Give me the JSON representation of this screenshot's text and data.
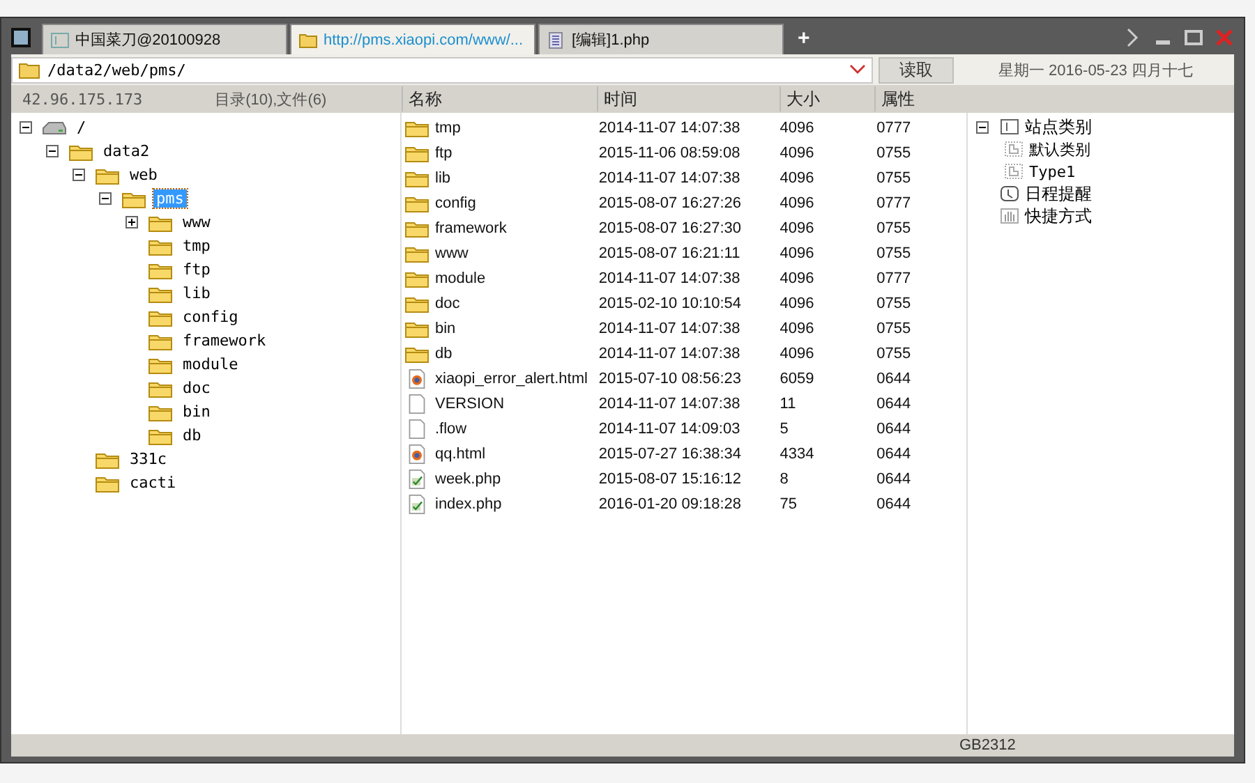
{
  "tabs": [
    {
      "label": "中国菜刀@20100928",
      "kind": "shell",
      "selected": false
    },
    {
      "label": "http://pms.xiaopi.com/www/...",
      "kind": "folder",
      "selected": true
    },
    {
      "label": "[编辑]1.php",
      "kind": "file",
      "selected": false
    }
  ],
  "new_tab": "+",
  "address": {
    "path": "/data2/web/pms/",
    "button": "读取",
    "date": "星期一 2016-05-23 四月十七"
  },
  "status": {
    "ip": "42.96.175.173",
    "summary": "目录(10),文件(6)"
  },
  "columns": [
    "名称",
    "时间",
    "大小",
    "属性"
  ],
  "tree": [
    {
      "label": "/",
      "kind": "drive",
      "expanded": true,
      "selected": false,
      "children": [
        {
          "label": "data2",
          "kind": "folder",
          "expanded": true,
          "selected": false,
          "children": [
            {
              "label": "web",
              "kind": "folder",
              "expanded": true,
              "selected": false,
              "children": [
                {
                  "label": "pms",
                  "kind": "folder",
                  "expanded": true,
                  "selected": true,
                  "children": [
                    {
                      "label": "www",
                      "kind": "folder",
                      "expanded": false,
                      "selected": false
                    },
                    {
                      "label": "tmp",
                      "kind": "folder",
                      "selected": false
                    },
                    {
                      "label": "ftp",
                      "kind": "folder",
                      "selected": false
                    },
                    {
                      "label": "lib",
                      "kind": "folder",
                      "selected": false
                    },
                    {
                      "label": "config",
                      "kind": "folder",
                      "selected": false
                    },
                    {
                      "label": "framework",
                      "kind": "folder",
                      "selected": false
                    },
                    {
                      "label": "module",
                      "kind": "folder",
                      "selected": false
                    },
                    {
                      "label": "doc",
                      "kind": "folder",
                      "selected": false
                    },
                    {
                      "label": "bin",
                      "kind": "folder",
                      "selected": false
                    },
                    {
                      "label": "db",
                      "kind": "folder",
                      "selected": false
                    }
                  ]
                }
              ]
            },
            {
              "label": "331c",
              "kind": "folder",
              "selected": false
            },
            {
              "label": "cacti",
              "kind": "folder",
              "selected": false
            }
          ]
        }
      ]
    }
  ],
  "files": [
    {
      "name": "tmp",
      "kind": "folder",
      "time": "2014-11-07 14:07:38",
      "size": "4096",
      "mode": "0777"
    },
    {
      "name": "ftp",
      "kind": "folder",
      "time": "2015-11-06 08:59:08",
      "size": "4096",
      "mode": "0755"
    },
    {
      "name": "lib",
      "kind": "folder",
      "time": "2014-11-07 14:07:38",
      "size": "4096",
      "mode": "0755"
    },
    {
      "name": "config",
      "kind": "folder",
      "time": "2015-08-07 16:27:26",
      "size": "4096",
      "mode": "0777"
    },
    {
      "name": "framework",
      "kind": "folder",
      "time": "2015-08-07 16:27:30",
      "size": "4096",
      "mode": "0755"
    },
    {
      "name": "www",
      "kind": "folder",
      "time": "2015-08-07 16:21:11",
      "size": "4096",
      "mode": "0755"
    },
    {
      "name": "module",
      "kind": "folder",
      "time": "2014-11-07 14:07:38",
      "size": "4096",
      "mode": "0777"
    },
    {
      "name": "doc",
      "kind": "folder",
      "time": "2015-02-10 10:10:54",
      "size": "4096",
      "mode": "0755"
    },
    {
      "name": "bin",
      "kind": "folder",
      "time": "2014-11-07 14:07:38",
      "size": "4096",
      "mode": "0755"
    },
    {
      "name": "db",
      "kind": "folder",
      "time": "2014-11-07 14:07:38",
      "size": "4096",
      "mode": "0755"
    },
    {
      "name": "xiaopi_error_alert.html",
      "kind": "html",
      "time": "2015-07-10 08:56:23",
      "size": "6059",
      "mode": "0644"
    },
    {
      "name": "VERSION",
      "kind": "text",
      "time": "2014-11-07 14:07:38",
      "size": "11",
      "mode": "0644"
    },
    {
      "name": ".flow",
      "kind": "text",
      "time": "2014-11-07 14:09:03",
      "size": "5",
      "mode": "0644"
    },
    {
      "name": "qq.html",
      "kind": "html",
      "time": "2015-07-27 16:38:34",
      "size": "4334",
      "mode": "0644"
    },
    {
      "name": "week.php",
      "kind": "php",
      "time": "2015-08-07 15:16:12",
      "size": "8",
      "mode": "0644"
    },
    {
      "name": "index.php",
      "kind": "php",
      "time": "2016-01-20 09:18:28",
      "size": "75",
      "mode": "0644"
    }
  ],
  "sites": [
    {
      "label": "站点类别",
      "kind": "category",
      "expanded": true,
      "children": [
        {
          "label": "默认类别",
          "kind": "subcategory"
        },
        {
          "label": "Type1",
          "kind": "subcategory"
        }
      ]
    },
    {
      "label": "日程提醒",
      "kind": "schedule"
    },
    {
      "label": "快捷方式",
      "kind": "shortcut"
    }
  ],
  "encoding": "GB2312"
}
